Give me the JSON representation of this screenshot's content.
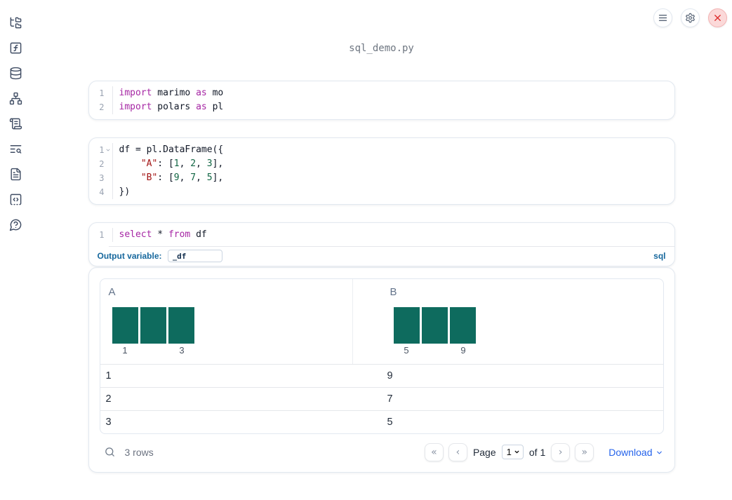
{
  "window": {
    "filename": "sql_demo.py"
  },
  "topbar": {
    "buttons": [
      {
        "name": "notebook-menu",
        "icon": "hamburger-menu-icon"
      },
      {
        "name": "settings",
        "icon": "gear-icon"
      },
      {
        "name": "shutdown",
        "icon": "close-x-icon"
      }
    ]
  },
  "sidebar": {
    "items": [
      {
        "name": "file-explorer",
        "icon": "folder-tree-icon"
      },
      {
        "name": "variables",
        "icon": "function-square-icon"
      },
      {
        "name": "data-sources",
        "icon": "database-icon"
      },
      {
        "name": "dependencies",
        "icon": "network-graph-icon"
      },
      {
        "name": "scratchpad",
        "icon": "scroll-text-icon"
      },
      {
        "name": "logs",
        "icon": "list-search-icon"
      },
      {
        "name": "documentation",
        "icon": "file-text-icon"
      },
      {
        "name": "snippets",
        "icon": "code-square-icon"
      },
      {
        "name": "help",
        "icon": "help-bubble-icon"
      }
    ]
  },
  "cells": [
    {
      "type": "python",
      "lines": [
        {
          "number": "1",
          "fold": false,
          "tokens": [
            {
              "t": "import",
              "c": "kw"
            },
            {
              "t": " marimo ",
              "c": "pl"
            },
            {
              "t": "as",
              "c": "kw"
            },
            {
              "t": " mo",
              "c": "pl"
            }
          ]
        },
        {
          "number": "2",
          "fold": false,
          "tokens": [
            {
              "t": "import",
              "c": "kw"
            },
            {
              "t": " polars ",
              "c": "pl"
            },
            {
              "t": "as",
              "c": "kw"
            },
            {
              "t": " pl",
              "c": "pl"
            }
          ]
        }
      ]
    },
    {
      "type": "python",
      "lines": [
        {
          "number": "1",
          "fold": true,
          "tokens": [
            {
              "t": "df = pl.DataFrame({",
              "c": "pl"
            }
          ]
        },
        {
          "number": "2",
          "fold": false,
          "tokens": [
            {
              "t": "    ",
              "c": "pl"
            },
            {
              "t": "\"A\"",
              "c": "str"
            },
            {
              "t": ": [",
              "c": "pl"
            },
            {
              "t": "1",
              "c": "num"
            },
            {
              "t": ", ",
              "c": "pl"
            },
            {
              "t": "2",
              "c": "num"
            },
            {
              "t": ", ",
              "c": "pl"
            },
            {
              "t": "3",
              "c": "num"
            },
            {
              "t": "],",
              "c": "pl"
            }
          ]
        },
        {
          "number": "3",
          "fold": false,
          "tokens": [
            {
              "t": "    ",
              "c": "pl"
            },
            {
              "t": "\"B\"",
              "c": "str"
            },
            {
              "t": ": [",
              "c": "pl"
            },
            {
              "t": "9",
              "c": "num"
            },
            {
              "t": ", ",
              "c": "pl"
            },
            {
              "t": "7",
              "c": "num"
            },
            {
              "t": ", ",
              "c": "pl"
            },
            {
              "t": "5",
              "c": "num"
            },
            {
              "t": "],",
              "c": "pl"
            }
          ]
        },
        {
          "number": "4",
          "fold": false,
          "tokens": [
            {
              "t": "})",
              "c": "pl"
            }
          ]
        }
      ]
    },
    {
      "type": "sql",
      "lines": [
        {
          "number": "1",
          "fold": false,
          "tokens": [
            {
              "t": "select",
              "c": "kw"
            },
            {
              "t": " * ",
              "c": "pl"
            },
            {
              "t": "from",
              "c": "kw"
            },
            {
              "t": " df",
              "c": "pl"
            }
          ]
        }
      ],
      "footer": {
        "label": "Output variable:",
        "value": "_df",
        "language": "sql"
      }
    }
  ],
  "output_table": {
    "columns": [
      {
        "header": "A",
        "summary": {
          "type": "histogram",
          "bars": [
            1,
            1,
            1
          ],
          "min_label": "1",
          "max_label": "3"
        }
      },
      {
        "header": "B",
        "summary": {
          "type": "histogram",
          "bars": [
            1,
            1,
            1
          ],
          "min_label": "5",
          "max_label": "9"
        }
      }
    ],
    "rows": [
      [
        "1",
        "9"
      ],
      [
        "2",
        "7"
      ],
      [
        "3",
        "5"
      ]
    ],
    "footer": {
      "row_count": "3 rows",
      "pagination": {
        "first_icon": "«",
        "prev_icon": "‹",
        "page_label": "Page",
        "page_value": "1",
        "of_label": "of 1",
        "next_icon": "›",
        "last_icon": "»"
      },
      "download_label": "Download"
    }
  },
  "colors": {
    "keyword": "#a626a4",
    "string": "#a31515",
    "number": "#116644",
    "bar": "#0e6b5e",
    "accent": "#17689d",
    "link": "#2563eb",
    "close_bg": "#fbd9d9",
    "close_border": "#f3b3b3",
    "close_icon": "#dc2626",
    "sidebar_icon": "#3f4c63"
  }
}
